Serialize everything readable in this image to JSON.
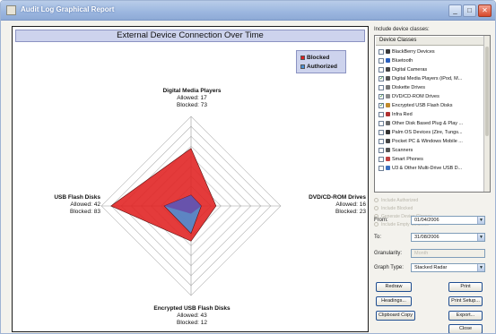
{
  "window": {
    "title": "Audit Log Graphical Report",
    "minimize": "_",
    "maximize": "□",
    "close": "✕"
  },
  "chart": {
    "title": "External Device Connection Over Time",
    "legend": [
      {
        "label": "Blocked",
        "color": "#e02020"
      },
      {
        "label": "Authorized",
        "color": "#4a8fd6"
      }
    ],
    "axes": {
      "top": {
        "name": "Digital Media Players",
        "allowed": "Allowed: 17",
        "blocked": "Blocked: 73"
      },
      "right": {
        "name": "DVD/CD-ROM Drives",
        "allowed": "Allowed: 16",
        "blocked": "Blocked: 23"
      },
      "bottom": {
        "name": "Encrypted USB Flash Disks",
        "allowed": "Allowed: 43",
        "blocked": "Blocked: 12"
      },
      "left": {
        "name": "USB Flash Disks",
        "allowed": "Allowed: 42",
        "blocked": "Blocked: 83"
      }
    }
  },
  "chart_data": {
    "type": "radar",
    "title": "External Device Connection Over Time",
    "axes": [
      "Digital Media Players",
      "DVD/CD-ROM Drives",
      "Encrypted USB Flash Disks",
      "USB Flash Disks"
    ],
    "series": [
      {
        "name": "Blocked",
        "values": [
          73,
          23,
          12,
          83
        ],
        "color": "#e02020"
      },
      {
        "name": "Authorized",
        "values": [
          17,
          16,
          43,
          42
        ],
        "color": "#4a8fd6"
      }
    ],
    "grid_rings": 9,
    "stacked": true,
    "legend_position": "top-right"
  },
  "side": {
    "include_label": "Include device classes:",
    "class_header": "Device Classes",
    "classes": [
      {
        "label": "BlackBerry Devices",
        "checked": false,
        "icon_color": "#3a3a3a"
      },
      {
        "label": "Bluetooth",
        "checked": false,
        "icon_color": "#2a5fbf"
      },
      {
        "label": "Digital Cameras",
        "checked": false,
        "icon_color": "#444444"
      },
      {
        "label": "Digital Media Players (iPod, M...",
        "checked": true,
        "icon_color": "#555555"
      },
      {
        "label": "Diskette Drives",
        "checked": false,
        "icon_color": "#777777"
      },
      {
        "label": "DVD/CD-ROM Drives",
        "checked": true,
        "icon_color": "#8a8a8a"
      },
      {
        "label": "Encrypted USB Flash Disks",
        "checked": true,
        "icon_color": "#c08a2a"
      },
      {
        "label": "Infra Red",
        "checked": false,
        "icon_color": "#b03030"
      },
      {
        "label": "Other Disk Based Plug & Play ...",
        "checked": false,
        "icon_color": "#666666"
      },
      {
        "label": "Palm OS Devices (Zire, Tungs...",
        "checked": false,
        "icon_color": "#333333"
      },
      {
        "label": "Pocket PC & Windows Mobile ...",
        "checked": false,
        "icon_color": "#444444"
      },
      {
        "label": "Scanners",
        "checked": false,
        "icon_color": "#555555"
      },
      {
        "label": "Smart Phones",
        "checked": false,
        "icon_color": "#c04040"
      },
      {
        "label": "U3 & Other Multi-Drive USB D...",
        "checked": false,
        "icon_color": "#3a6fc0"
      }
    ],
    "options": [
      "Include Authorized",
      "Include Blocked",
      "Generate Device Classes",
      "Include Empty Columns"
    ],
    "from_label": "From:",
    "from_value": "01/04/2006",
    "to_label": "To:",
    "to_value": "31/08/2006",
    "granularity_label": "Granularity:",
    "granularity_value": "Month",
    "graph_type_label": "Graph Type:",
    "graph_type_value": "Stacked Radar",
    "buttons": {
      "redraw": "Redraw",
      "headings": "Headings...",
      "clipboard": "Clipboard Copy",
      "print": "Print",
      "print_setup": "Print Setup...",
      "export": "Export...",
      "close": "Close"
    }
  }
}
